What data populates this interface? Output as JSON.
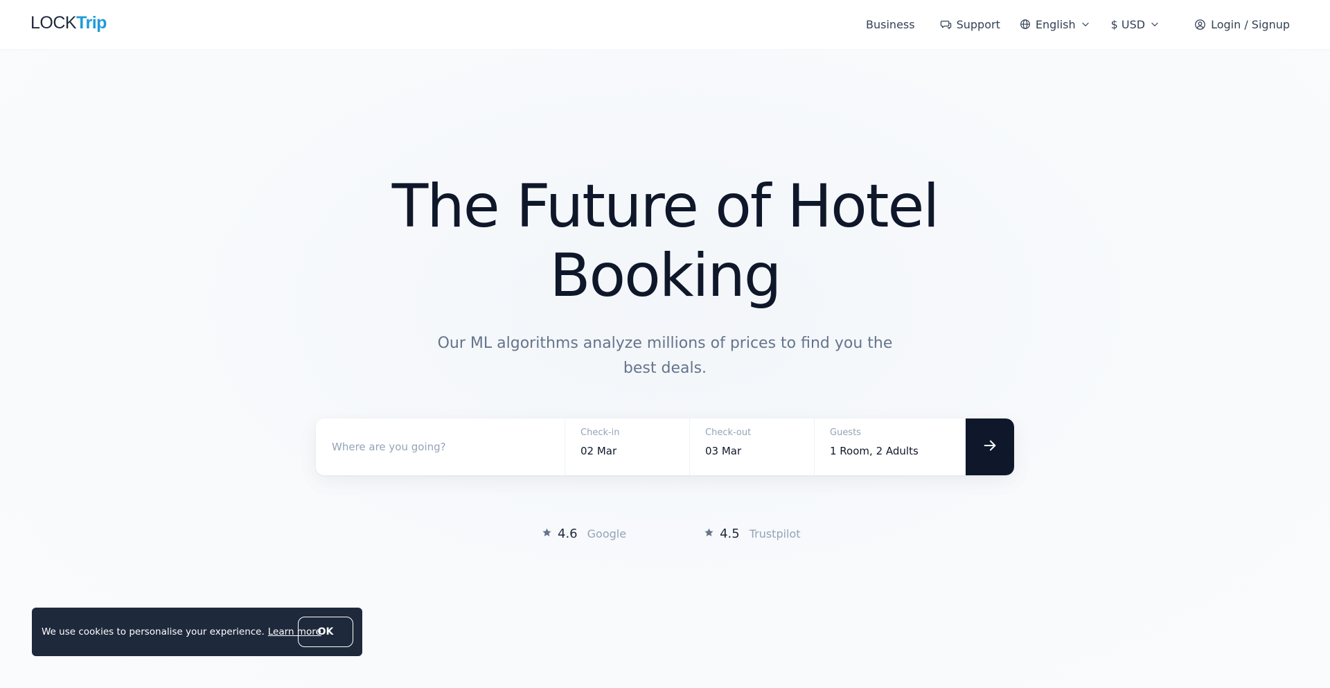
{
  "header": {
    "logo_part1": "LOCK",
    "logo_part2": "Trip",
    "nav": {
      "business": "Business",
      "support": "Support",
      "language": "English",
      "currency": "$ USD",
      "login": "Login / Signup"
    }
  },
  "hero": {
    "title": "The Future of Hotel Booking",
    "subtitle": "Our ML algorithms analyze millions of prices to find you the best deals."
  },
  "search": {
    "destination_placeholder": "Where are you going?",
    "checkin_label": "Check-in",
    "checkin_value": "02 Mar",
    "checkout_label": "Check-out",
    "checkout_value": "03 Mar",
    "guests_label": "Guests",
    "guests_value": "1 Room, 2 Adults"
  },
  "ratings": [
    {
      "score": "4.6",
      "source": "Google"
    },
    {
      "score": "4.5",
      "source": "Trustpilot"
    }
  ],
  "cookie": {
    "text": "We use cookies to personalise your experience.",
    "link": "Learn more",
    "button": "OK"
  },
  "colors": {
    "brand_blue": "#1f9bd7",
    "dark": "#0f172a",
    "cookie_bg": "#1e293b",
    "muted": "#94a3b8"
  },
  "icons": {
    "support": "chat-icon",
    "language": "globe-icon",
    "dropdown": "chevron-down-icon",
    "login": "user-circle-icon",
    "search": "arrow-right-icon",
    "rating": "star-icon"
  }
}
